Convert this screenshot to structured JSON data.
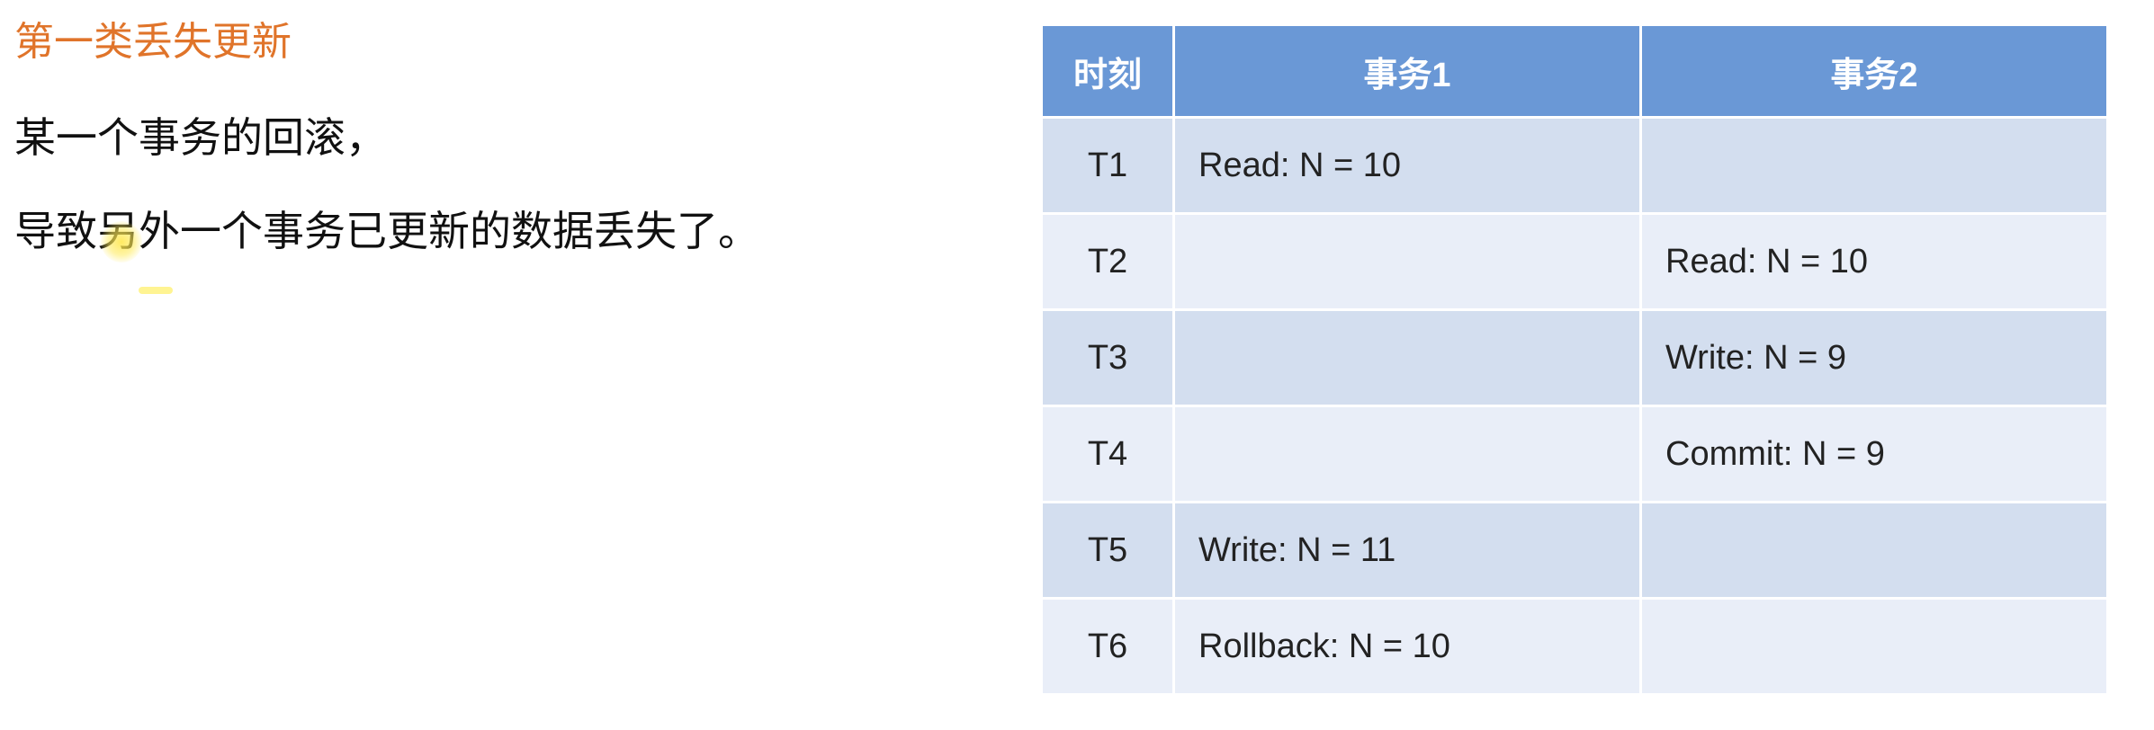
{
  "title": "第一类丢失更新",
  "paragraphs": [
    "某一个事务的回滚，",
    "导致另外一个事务已更新的数据丢失了。"
  ],
  "table": {
    "headers": [
      "时刻",
      "事务1",
      "事务2"
    ],
    "rows": [
      {
        "time": "T1",
        "tx1": "Read: N = 10",
        "tx2": ""
      },
      {
        "time": "T2",
        "tx1": "",
        "tx2": "Read: N = 10"
      },
      {
        "time": "T3",
        "tx1": "",
        "tx2": "Write: N = 9"
      },
      {
        "time": "T4",
        "tx1": "",
        "tx2": "Commit: N = 9"
      },
      {
        "time": "T5",
        "tx1": "Write: N = 11",
        "tx2": ""
      },
      {
        "time": "T6",
        "tx1": "Rollback: N = 10",
        "tx2": ""
      }
    ]
  },
  "colors": {
    "title": "#e0742a",
    "header_bg": "#6a98d6",
    "row_odd_bg": "#d3deef",
    "row_even_bg": "#e9eef8"
  }
}
